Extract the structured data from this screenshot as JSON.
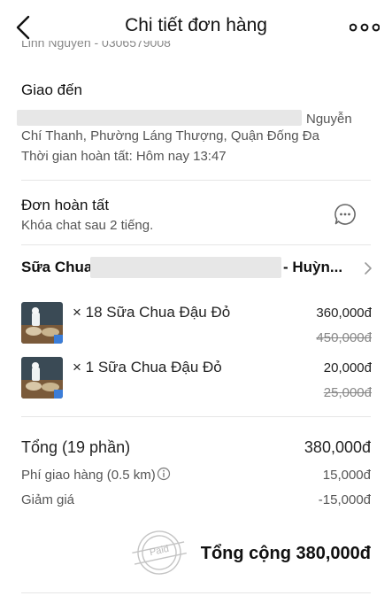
{
  "header": {
    "title": "Chi tiết đơn hàng",
    "back_icon": "chevron-left-icon",
    "more_icon": "more-dots-icon"
  },
  "cutoff_text": "Linh Nguyễn - 0306579008",
  "delivery": {
    "title": "Giao đến",
    "address_line1_tail": "Nguyễn",
    "address_line2": "Chí Thanh, Phường Láng Thượng, Quận Đống Đa",
    "completed_time": "Thời gian hoàn tất: Hôm nay 13:47"
  },
  "status": {
    "title": "Đơn hoàn tất",
    "subtitle": "Khóa chat sau 2 tiếng.",
    "chat_icon": "chat-bubble-icon"
  },
  "shop": {
    "name_prefix": "Sữa Chua",
    "name_suffix": "- Huỳn...",
    "chevron_icon": "chevron-right-icon"
  },
  "items": [
    {
      "qty_name": "× 18  Sữa Chua Đậu Đỏ",
      "price": "360,000đ",
      "old_price": "450,000đ"
    },
    {
      "qty_name": "× 1  Sữa Chua Đậu Đỏ",
      "price": "20,000đ",
      "old_price": "25,000đ"
    }
  ],
  "summary": {
    "subtotal_label": "Tổng (19 phần)",
    "subtotal_value": "380,000đ",
    "shipping_label": "Phí giao hàng (0.5 km)",
    "shipping_value": "15,000đ",
    "discount_label": "Giảm giá",
    "discount_value": "-15,000đ",
    "grand_total": "Tổng cộng 380,000đ",
    "paid_stamp": "Paid",
    "info_icon": "info-circle-icon"
  }
}
